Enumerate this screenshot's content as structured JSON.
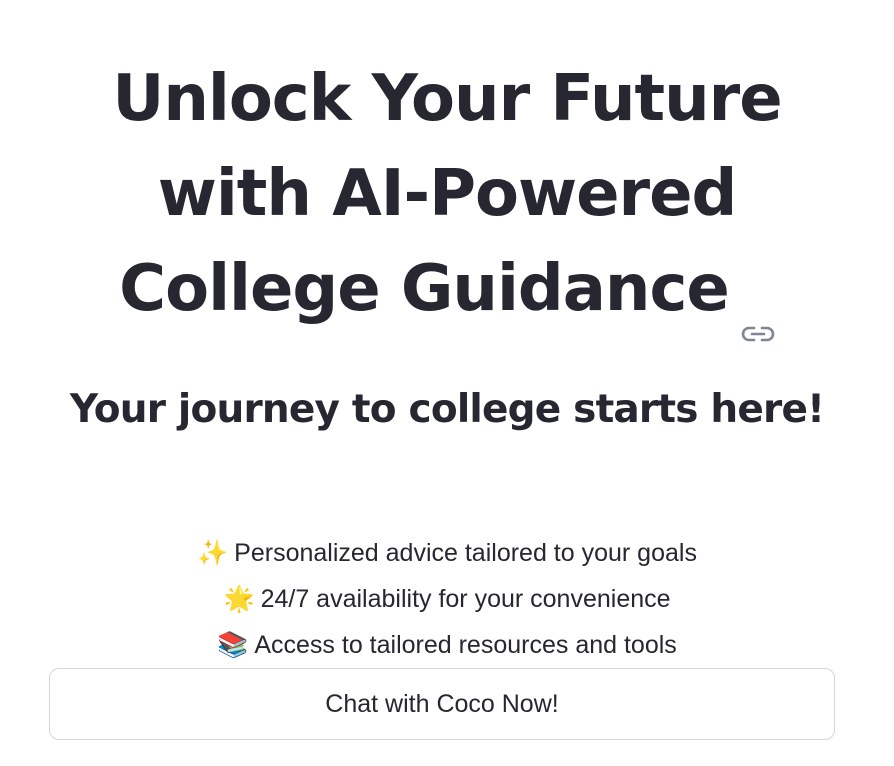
{
  "hero": {
    "title_lines": [
      "Unlock Your Future",
      "with AI-Powered",
      "College Guidance"
    ],
    "anchor_icon": "link-icon"
  },
  "subtitle": "Your journey to college starts here!",
  "features": [
    {
      "icon": "sparkles-emoji",
      "emoji": "✨",
      "text": "Personalized advice tailored to your goals"
    },
    {
      "icon": "glowing-star-emoji",
      "emoji": "🌟",
      "text": "24/7 availability for your convenience"
    },
    {
      "icon": "books-emoji",
      "emoji": "📚",
      "text": "Access to tailored resources and tools"
    }
  ],
  "cta": {
    "label": "Chat with Coco Now!"
  },
  "colors": {
    "text": "#262730",
    "icon": "#808495",
    "button_border": "#d5d6db",
    "background": "#ffffff"
  }
}
